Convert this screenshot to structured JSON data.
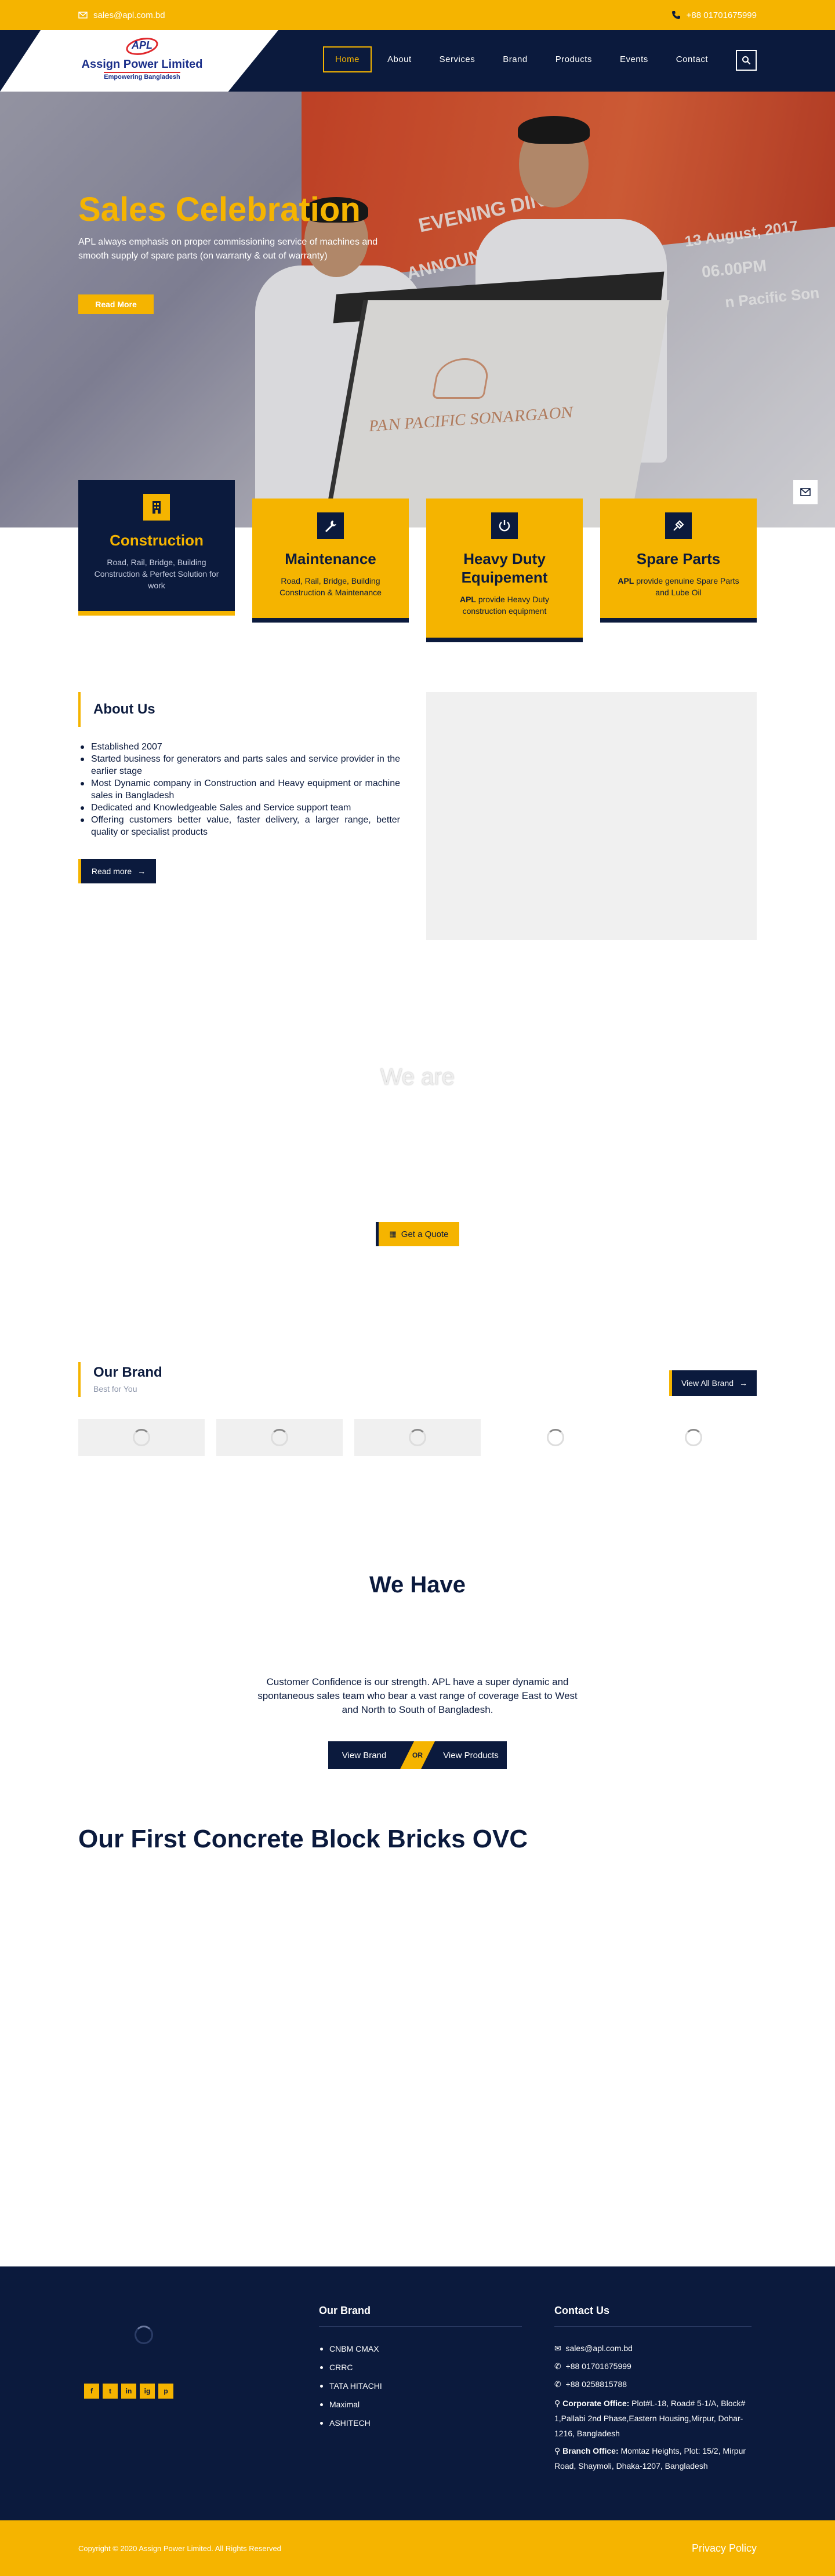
{
  "topbar": {
    "email": "sales@apl.com.bd",
    "phone": "+88 01701675999"
  },
  "logo": {
    "mark": "APL",
    "name": "Assign Power Limited",
    "tagline": "Empowering Bangladesh"
  },
  "nav": {
    "items": [
      "Home",
      "About",
      "Services",
      "Brand",
      "Products",
      "Events",
      "Contact"
    ],
    "active": "Home"
  },
  "hero": {
    "title": "Sales Celebration",
    "text": "APL always emphasis on proper commissioning service of machines and smooth supply of spare parts (on warranty & out of warranty)",
    "button": "Read More",
    "banner_lines": [
      "EVENING DIN",
      "13 August, 2017",
      "06.00PM",
      "n Pacific Son",
      "ANNOUNC"
    ],
    "lectern_text": "PAN PACIFIC SONARGAON"
  },
  "cards": [
    {
      "title": "Construction",
      "text": "Road, Rail, Bridge, Building Construction & Perfect Solution for work",
      "icon": "building-icon"
    },
    {
      "title": "Maintenance",
      "text": "Road, Rail, Bridge, Building Construction & Maintenance",
      "icon": "wrench-icon"
    },
    {
      "title": "Heavy Duty Equipement",
      "bold": "APL",
      "text": " provide Heavy Duty construction equipment",
      "icon": "power-icon"
    },
    {
      "title": "Spare Parts",
      "bold": "APL",
      "text": " provide genuine Spare Parts and Lube Oil",
      "icon": "parts-icon"
    }
  ],
  "about": {
    "title": "About Us",
    "items": [
      "Established 2007",
      "Started business for generators and parts sales and service provider in the earlier stage",
      "Most Dynamic company in Construction and Heavy equipment or machine sales in Bangladesh",
      "Dedicated and Knowledgeable Sales and Service support team",
      "Offering customers better value, faster delivery, a larger range, better quality or specialist products"
    ],
    "button": "Read more"
  },
  "we_are": {
    "title": "We are",
    "button": "Get a Quote"
  },
  "brand_section": {
    "title": "Our Brand",
    "subtitle": "Best for You",
    "button": "View All Brand"
  },
  "we_have": {
    "title": "We Have",
    "text": "Customer Confidence is our strength. APL have a super dynamic and spontaneous sales team who bear a vast range of coverage East to West and North to South of Bangladesh.",
    "btn_left": "View Brand",
    "btn_mid": "OR",
    "btn_right": "View Products"
  },
  "ovc": {
    "title": "Our First Concrete Block Bricks OVC"
  },
  "footer": {
    "brand_title": "Our Brand",
    "brands": [
      "CNBM CMAX",
      "CRRC",
      "TATA HITACHI",
      "Maximal",
      "ASHITECH"
    ],
    "contact_title": "Contact Us",
    "email": "sales@apl.com.bd",
    "phone1": "+88 01701675999",
    "phone2": "+88 0258815788",
    "corporate_label": "Corporate Office:",
    "corporate_addr": "Plot#L-18, Road# 5-1/A, Block# 1,Pallabi 2nd Phase,Eastern Housing,Mirpur, Dohar-1216, Bangladesh",
    "branch_label": "Branch Office:",
    "branch_addr": "Momtaz Heights, Plot: 15/2, Mirpur Road, Shaymoli, Dhaka-1207, Bangladesh",
    "social": [
      "f",
      "t",
      "in",
      "ig",
      "p"
    ]
  },
  "bottom": {
    "copyright": "Copyright © 2020 Assign Power Limited. All Rights Reserved",
    "privacy": "Privacy Policy"
  },
  "colors": {
    "navy": "#0b1a3d",
    "gold": "#f5b400"
  }
}
